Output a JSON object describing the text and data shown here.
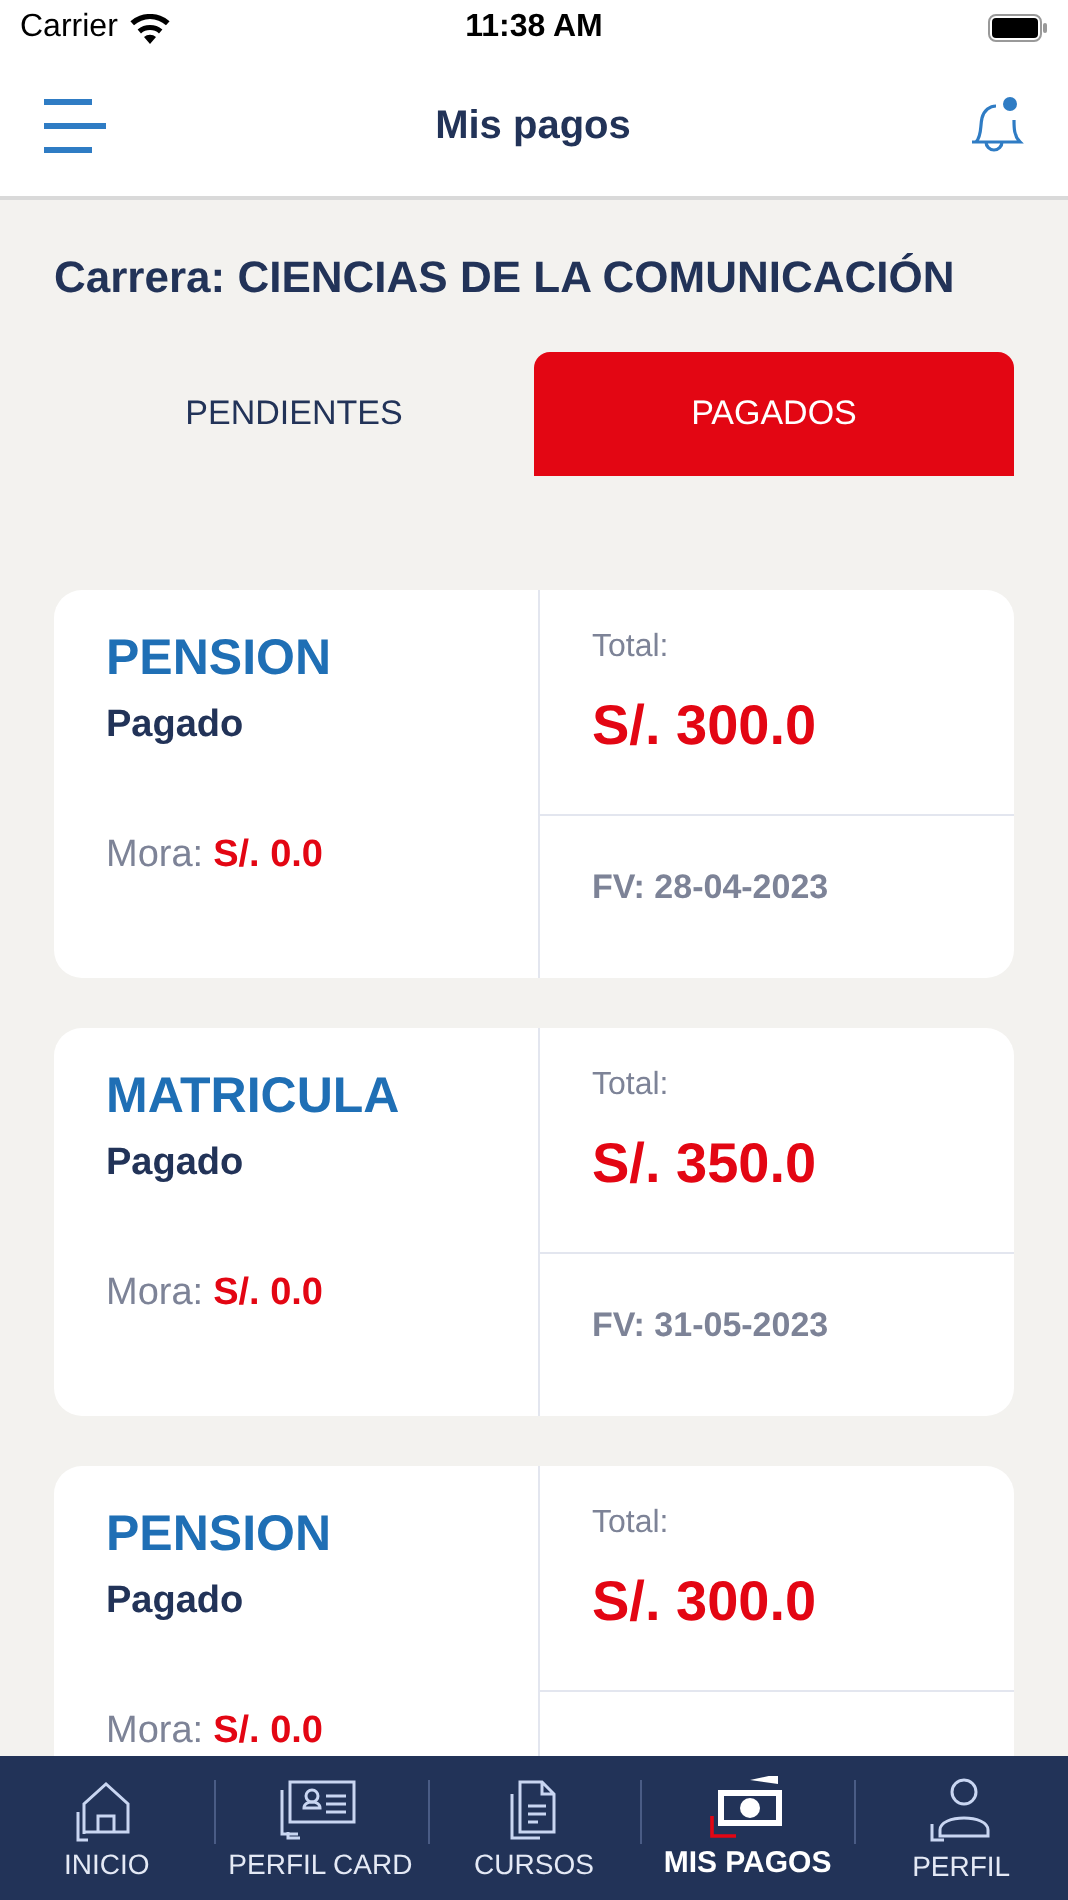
{
  "status_bar": {
    "carrier": "Carrier",
    "time": "11:38 AM"
  },
  "header": {
    "title": "Mis pagos",
    "has_notification": true
  },
  "career": "Carrera: CIENCIAS DE LA COMUNICACIÓN",
  "tabs": [
    {
      "label": "PENDIENTES",
      "selected": false
    },
    {
      "label": "PAGADOS",
      "selected": true
    }
  ],
  "payments": [
    {
      "concept": "PENSION",
      "status": "Pagado",
      "mora_label": "Mora:",
      "mora": "S/. 0.0",
      "total_label": "Total:",
      "total": "S/. 300.0",
      "fv": "FV: 28-04-2023"
    },
    {
      "concept": "MATRICULA",
      "status": "Pagado",
      "mora_label": "Mora:",
      "mora": "S/. 0.0",
      "total_label": "Total:",
      "total": "S/. 350.0",
      "fv": "FV: 31-05-2023"
    },
    {
      "concept": "PENSION",
      "status": "Pagado",
      "mora_label": "Mora:",
      "mora": "S/. 0.0",
      "total_label": "Total:",
      "total": "S/. 300.0"
    }
  ],
  "nav": [
    {
      "kind": "home",
      "label": "INICIO",
      "selected": false
    },
    {
      "kind": "card",
      "label": "PERFIL CARD",
      "selected": false
    },
    {
      "kind": "document",
      "label": "CURSOS",
      "selected": false
    },
    {
      "kind": "money",
      "label": "MIS PAGOS",
      "selected": true
    },
    {
      "kind": "person",
      "label": "PERFIL",
      "selected": false
    }
  ]
}
